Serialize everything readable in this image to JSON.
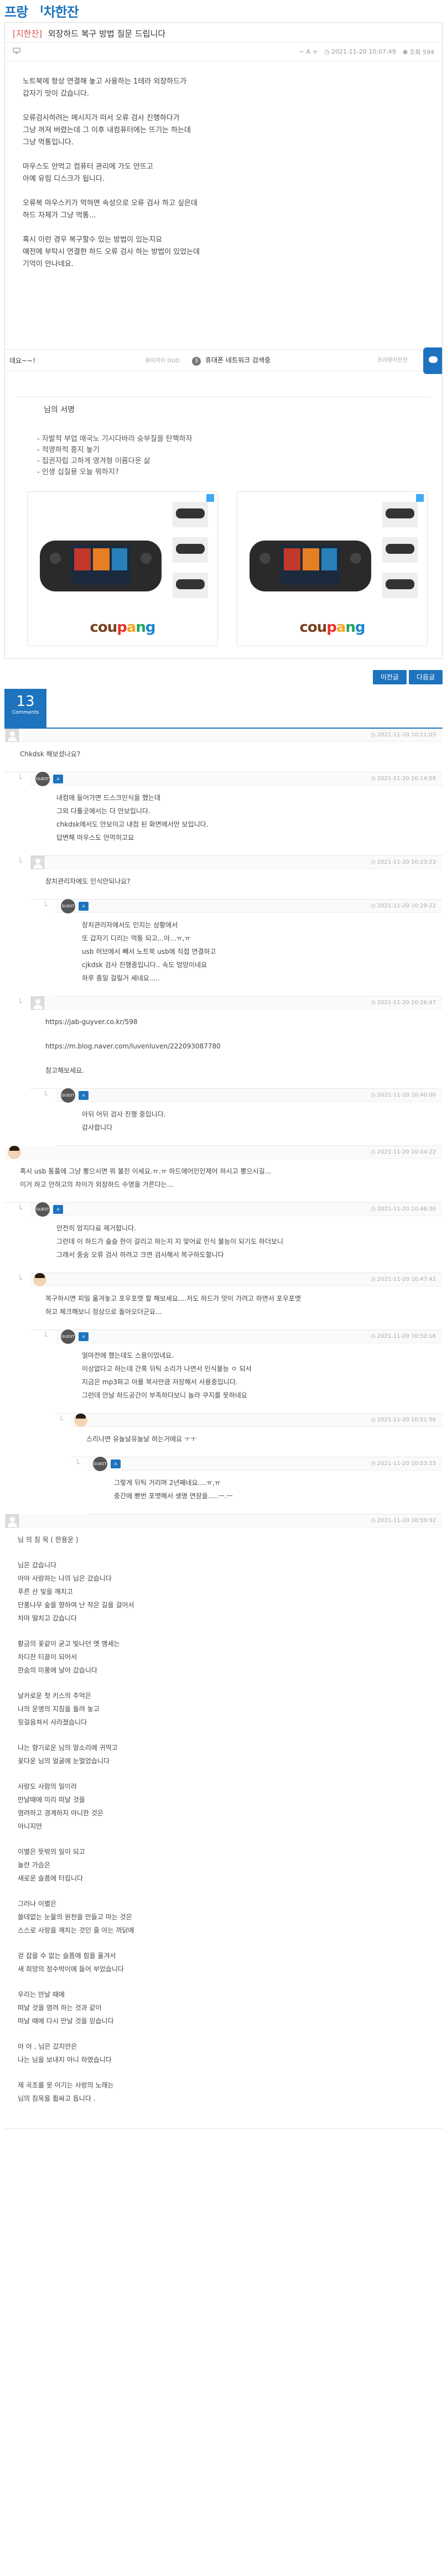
{
  "site": {
    "title": "프랑 ᅵ차한잔"
  },
  "post": {
    "category": "[지한잔]",
    "title": "외장하드 복구 방법 질문 드립니다",
    "date": "2021-11-20 10:07:49",
    "views": "조회 594",
    "font_minus": "−",
    "font_label": "A",
    "font_plus": "+",
    "paragraphs": [
      [
        "노트북에 항상 연결해 놓고 사용하는 1테라 외장하드가",
        "갑자기 맛이 갔습니다."
      ],
      [
        "오류검사하려는 메시지가 떠서 오류 검사 진행하다가",
        "그냥 꺼져 버렸는데 그 이후 내컴퓨터에는 뜨기는 하는데",
        "그냥 먹통입니다."
      ],
      [
        "마우스도 안먹고 컴퓨터 관리에 가도 안뜨고",
        "아예 유림 디스크가 됩니다."
      ],
      [
        "오류복 마우스키가 먹혀면 속성으로 오류 검사 하고 싶은데",
        "하드 자체가 그냥 먹통..."
      ],
      [
        "혹시 이런 경우 복구할수 있는 방법이 있는지요",
        "얘전에 부탁시 연결한 하드 오류 검사 하는 방법이 있었는데",
        "기억이 안나네요."
      ]
    ]
  },
  "nav": {
    "prev_title": "데요~~!",
    "prev_author": "용미끼이 DUD",
    "next_num": "3",
    "next_title": "휴대폰 네트워크 검색중",
    "next_author": "프라랑차한잔"
  },
  "signature": {
    "title": "님의 서명",
    "lines": [
      "- 자발적 부업 애국노 기시다바라 승부질을 탄핵하자",
      "- 적영하적 흥지 놓기",
      "- 집권자립 고하게 영겨형 이름다운 삶",
      "- 인생 십질용 오늘 뭐하지?"
    ]
  },
  "ads": [
    {
      "brand": [
        "cou",
        "p",
        "a",
        "n",
        "g"
      ]
    },
    {
      "brand": [
        "cou",
        "p",
        "a",
        "n",
        "g"
      ]
    }
  ],
  "buttons": {
    "list": "이전글",
    "next": "다음글"
  },
  "comments_header": {
    "count": "13",
    "label": "Comments"
  },
  "comments": [
    {
      "avatar": "gray",
      "indent": 0,
      "author": "",
      "time": "2021-11-20 10:11:03",
      "lines": [
        "Chkdsk 해보셨나요?"
      ]
    },
    {
      "avatar": "dark",
      "badge": true,
      "indent": 1,
      "time": "2021-11-20 10:14:58",
      "lines": [
        "내컴에 들어가면 드스크인식을 했는데",
        "그외 다툴곳에서는 다 안보입니다.",
        "chkdsk에서도 안보이고 내컴 된 화면에서만 보입니다.",
        "답변해 마우스도 안먹히고요"
      ]
    },
    {
      "avatar": "gray",
      "indent": 2,
      "time": "2021-11-20 10:23:23",
      "lines": [
        "장치관리자에도 인식안되나요?"
      ]
    },
    {
      "avatar": "dark",
      "badge": true,
      "indent": 3,
      "time": "2021-11-20 10:29:22",
      "lines": [
        "장치관리자에서도 인지는 상황에서",
        "또 갑자기 디리는 먹통 되고...아...ㅠ,ㅠ",
        "usb 허브에서 빼서 노트북 usb에 직접 연결하고",
        "cjkdsk 검사 진행중입니다.. 속도 엉망이네요",
        "하루 종일 걸릴거 세네요....."
      ]
    },
    {
      "avatar": "gray",
      "indent": 2,
      "time": "2021-11-20 10:26:47",
      "lines": [
        "https://jab-guyver.co.kr/598",
        "",
        "https://m.blog.naver.com/luvenluven/222093087780",
        "",
        "참고해보세요."
      ]
    },
    {
      "avatar": "dark",
      "badge": true,
      "indent": 3,
      "time": "2021-11-20 10:40:00",
      "lines": [
        "아뒤 어뒤 검사 진행 중입니다.",
        "감사합니다"
      ]
    },
    {
      "avatar": "face",
      "indent": 0,
      "time": "2021-11-20 10:44:22",
      "lines": [
        "혹시 usb 통풀에 그냥 뽕으시면 뭐 불친 이세요.ㅠ.ㅠ 하드에어인인제어 하시고 뽕으시길...",
        "이거 하고 안하고의 차이가 외장하드 수명을 가른다는..."
      ]
    },
    {
      "avatar": "dark",
      "badge": true,
      "indent": 1,
      "time": "2021-11-20 10:46:30",
      "lines": [
        "안전히 암지다료 제거합니다.",
        "그런데 이 하드가 솔슬 한이 갈리고 하는지 지 맞어료 인식 불능이 되기도 하더보니",
        "그래서 중숭 오류 검사 하려고 크면 검사해서 복구하도할니다"
      ]
    },
    {
      "avatar": "face",
      "indent": 2,
      "time": "2021-11-20 10:47:42",
      "lines": [
        "복구하시면 피일 옮겨놓고 포우포맷 할 해보세요....저도 하드가 맛이 가려고 하면서 포우포맷",
        "하고 체크해보니 정상으로 돌아오더군요..."
      ]
    },
    {
      "avatar": "dark",
      "badge": true,
      "indent": 3,
      "time": "2021-11-20 10:50:16",
      "lines": [
        "얼마전에 했는데도 스용이었네요.",
        "이상없다고 하는데 간혹 뒤틱 소리가 나면서 인식불능 ㅇ 되서",
        "지금은 mp3파고 아를 복사만큼 저장해서 사용중입니다.",
        "그런데 안날 하드공간이 부족하다보니 놀라 쿠지를 못하네요"
      ]
    },
    {
      "avatar": "face",
      "indent": 4,
      "time": "2021-11-20 10:51:56",
      "lines": [
        "스리나면 유놀날유놀날 하는거에요 ㅜㅜ"
      ]
    },
    {
      "avatar": "dark",
      "badge": true,
      "indent": 5,
      "time": "2021-11-20 10:53:23",
      "lines": [
        "그렇게 뒤틱 거리며 2년째네요....ㅠ,ㅠ",
        "중간에 뻗번 포맷해서 생명 연장을.....ㅡ.ㅡ"
      ]
    },
    {
      "avatar": "gray",
      "indent": 0,
      "time": "2021-11-20 10:59:32",
      "poem": true,
      "lines": [
        [
          "님 의 침 묵  ( 한용운 )"
        ],
        [
          "님은 갔습니다",
          "아아 사랑하는 나의 님은 갔습니다",
          "푸른 산 빛을 깨치고",
          "단풍나무 숲을 향하여 난 작은 길을 걸어서",
          "차마 떨치고 갔습니다"
        ],
        [
          "황금의 꽃같이 굳고 빛나던 옛 맹세는",
          "차디찬 티끌이 되어서",
          "한숨의 미풍에 날아 갔습니다"
        ],
        [
          "날카로운 첫 키스의 추억은",
          "나의 운명의 지침을 돌려 놓고",
          "뒷걸음쳐서 사라졌습니다"
        ],
        [
          "나는 향기로운 님의 말소리에 귀먹고",
          "꽃다운 님의 얼굴에 눈멀었습니다"
        ],
        [
          "사랑도 사람의 일이라",
          "만날때에 미리 떠날 것을",
          "염려하고 경계하지 아니한 것은",
          "아니지만"
        ],
        [
          "이별은 뜻밖의 일이 되고",
          "놀란 가슴은",
          "새로운 슬픔에 터집니다"
        ],
        [
          "그러나 이별은",
          "쓸데없는 눈물의 원천을 만들고 마는 것은",
          "스스로 사랑을 깨치는 것인 줄 아는 까닭에"
        ],
        [
          "걷 잡을 수 없는 슬픔에 힘을 옮겨서",
          "새 희망의 정수박이에 들어 부었습니다"
        ],
        [
          "우리는 만날 때에",
          "떠날 것을 염려 하는 것과 같이",
          "떠날 때에 다시 만날 것을 믿습니다"
        ],
        [
          "아 아 , 님은 갔지만은",
          "나는 님을 보내지 아니 하였습니다"
        ],
        [
          "제 곡조를 못 이기는 사랑의 노래는",
          "님의 침묵을 휩싸고 돕니다 ."
        ]
      ]
    }
  ]
}
